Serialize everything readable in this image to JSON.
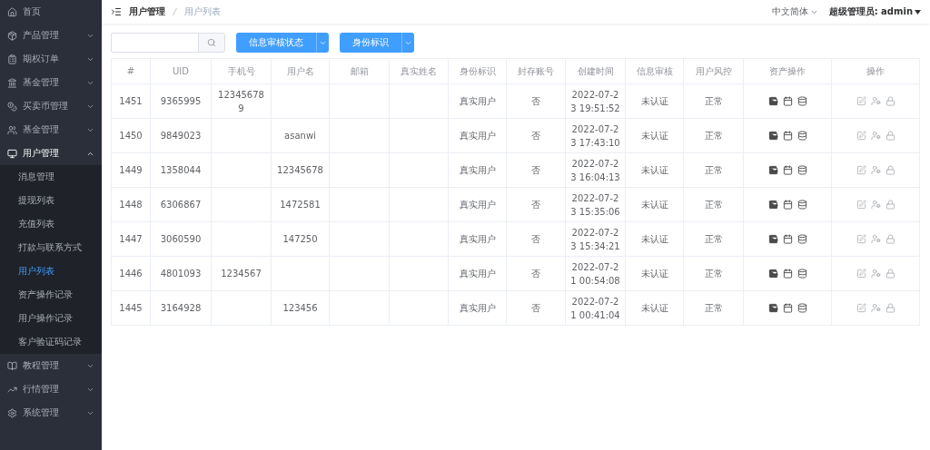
{
  "sidebar": {
    "items": [
      {
        "label": "首页",
        "expanded": false
      },
      {
        "label": "产品管理",
        "expanded": false
      },
      {
        "label": "期权订单",
        "expanded": false
      },
      {
        "label": "基金管理",
        "expanded": false
      },
      {
        "label": "买卖币管理",
        "expanded": false
      },
      {
        "label": "基金管理",
        "expanded": false
      },
      {
        "label": "用户管理",
        "expanded": true,
        "children": [
          {
            "label": "消息管理",
            "selected": false
          },
          {
            "label": "提现列表",
            "selected": false
          },
          {
            "label": "充值列表",
            "selected": false
          },
          {
            "label": "打款与联系方式",
            "selected": false
          },
          {
            "label": "用户列表",
            "selected": true
          },
          {
            "label": "资产操作记录",
            "selected": false
          },
          {
            "label": "用户操作记录",
            "selected": false
          },
          {
            "label": "客户验证码记录",
            "selected": false
          }
        ]
      },
      {
        "label": "教程管理",
        "expanded": false
      },
      {
        "label": "行情管理",
        "expanded": false
      },
      {
        "label": "系统管理",
        "expanded": false
      }
    ]
  },
  "breadcrumb": [
    "用户管理",
    "用户列表"
  ],
  "header": {
    "language": "中文简体",
    "user": "超级管理员: admin"
  },
  "toolbar": {
    "buttons": [
      "信息审核状态",
      "身份标识"
    ]
  },
  "table": {
    "columns": [
      "#",
      "UID",
      "手机号",
      "用户名",
      "邮箱",
      "真实姓名",
      "身份标识",
      "封存账号",
      "创建时间",
      "信息审核",
      "用户风控",
      "资产操作",
      "操作"
    ],
    "rows": [
      {
        "id": "1451",
        "uid": "9365995",
        "phone": "123456789",
        "identity": "真实用户",
        "frozen": "否",
        "created": "2022-07-23 19:51:52",
        "review": "未认证",
        "risk": "正常"
      },
      {
        "id": "1450",
        "uid": "9849023",
        "username": "asanwi",
        "identity": "真实用户",
        "frozen": "否",
        "created": "2022-07-23 17:43:10",
        "review": "未认证",
        "risk": "正常"
      },
      {
        "id": "1449",
        "uid": "1358044",
        "username": "12345678",
        "identity": "真实用户",
        "frozen": "否",
        "created": "2022-07-23 16:04:13",
        "review": "未认证",
        "risk": "正常"
      },
      {
        "id": "1448",
        "uid": "6306867",
        "username": "1472581",
        "identity": "真实用户",
        "frozen": "否",
        "created": "2022-07-23 15:35:06",
        "review": "未认证",
        "risk": "正常"
      },
      {
        "id": "1447",
        "uid": "3060590",
        "username": "147250",
        "identity": "真实用户",
        "frozen": "否",
        "created": "2022-07-23 15:34:21",
        "review": "未认证",
        "risk": "正常"
      },
      {
        "id": "1446",
        "uid": "4801093",
        "phone": "1234567",
        "identity": "真实用户",
        "frozen": "否",
        "created": "2022-07-21 00:54:08",
        "review": "未认证",
        "risk": "正常"
      },
      {
        "id": "1445",
        "uid": "3164928",
        "username": "123456",
        "identity": "真实用户",
        "frozen": "否",
        "created": "2022-07-21 00:41:04",
        "review": "未认证",
        "risk": "正常"
      }
    ]
  }
}
